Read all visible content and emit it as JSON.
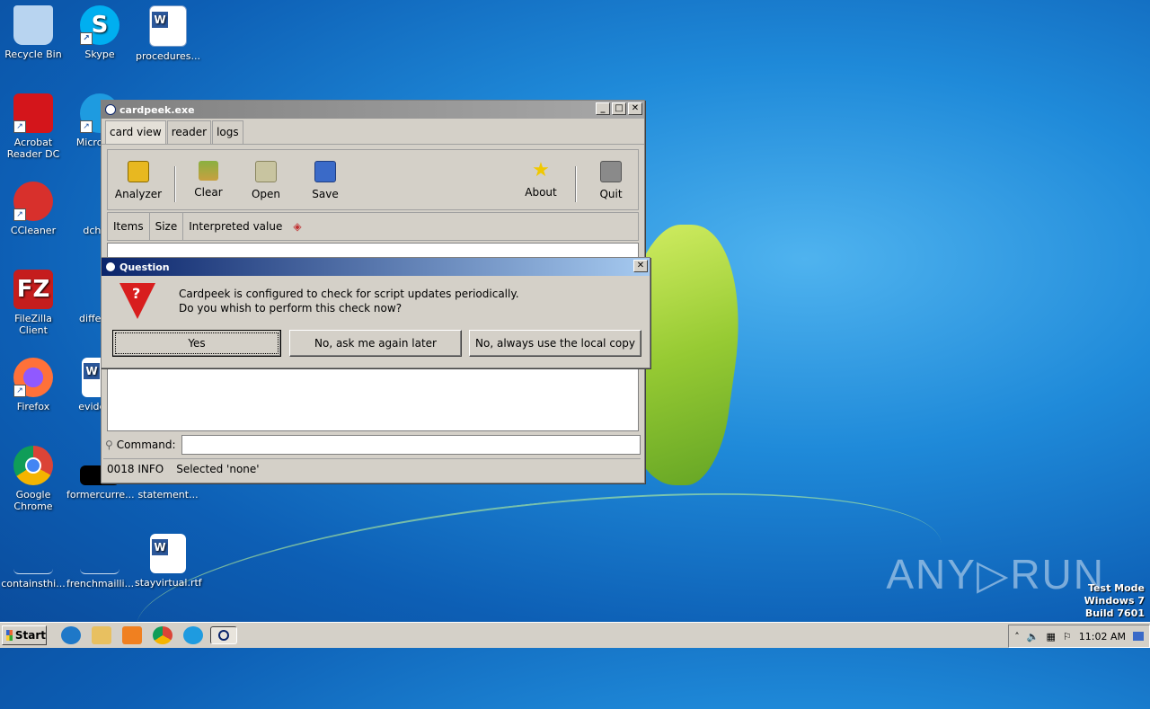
{
  "desktop": {
    "icons": [
      {
        "label": "Recycle Bin",
        "icon": "recycle-bin-icon",
        "color": "#b8d4f0"
      },
      {
        "label": "Skype",
        "icon": "skype-icon",
        "color": "#00aff0"
      },
      {
        "label": "procedures...",
        "icon": "word-document-icon",
        "color": "#2b579a"
      },
      {
        "label": "Acrobat Reader DC",
        "icon": "acrobat-icon",
        "color": "#d4151b"
      },
      {
        "label": "Microso...",
        "icon": "edge-icon",
        "color": "#1e9be0"
      },
      {
        "label": "CCleaner",
        "icon": "ccleaner-icon",
        "color": "#d8302c"
      },
      {
        "label": "dcha...",
        "icon": "file-icon",
        "color": "#1a6fc4"
      },
      {
        "label": "FileZilla Client",
        "icon": "filezilla-icon",
        "color": "#c51d1d"
      },
      {
        "label": "differe...",
        "icon": "file-icon",
        "color": "#1a6fc4"
      },
      {
        "label": "Firefox",
        "icon": "firefox-icon",
        "color": "#ff7139"
      },
      {
        "label": "eviden...",
        "icon": "word-document-icon",
        "color": "#2b579a"
      },
      {
        "label": "Google Chrome",
        "icon": "chrome-icon",
        "color": "#4285f4"
      },
      {
        "label": "formercurre...",
        "icon": "black-file-icon",
        "color": "#000000"
      },
      {
        "label": "statement...",
        "icon": "file-icon",
        "color": "#1a6fc4"
      },
      {
        "label": "containsthi...",
        "icon": "file-icon",
        "color": "#1a6fc4"
      },
      {
        "label": "frenchmailli...",
        "icon": "file-icon",
        "color": "#1a6fc4"
      },
      {
        "label": "stayvirtual.rtf",
        "icon": "word-document-icon",
        "color": "#2b579a"
      }
    ]
  },
  "main_window": {
    "title": "cardpeek.exe",
    "tabs": [
      {
        "label": "card view"
      },
      {
        "label": "reader"
      },
      {
        "label": "logs"
      }
    ],
    "toolbar": {
      "analyzer": "Analyzer",
      "clear": "Clear",
      "open": "Open",
      "save": "Save",
      "about": "About",
      "quit": "Quit"
    },
    "columns": {
      "items": "Items",
      "size": "Size",
      "interpreted": "Interpreted value"
    },
    "command_label": "Command:",
    "command_value": "",
    "status": {
      "code": "0018 INFO",
      "message": "Selected 'none'"
    }
  },
  "dialog": {
    "title": "Question",
    "message_line1": "Cardpeek is configured to check for script updates periodically.",
    "message_line2": "Do you whish to perform this check now?",
    "buttons": {
      "yes": "Yes",
      "later": "No, ask me again later",
      "local": "No, always use the local copy"
    }
  },
  "taskbar": {
    "start": "Start",
    "clock": "11:02 AM"
  },
  "watermark": "ANY▷RUN",
  "os_notice": {
    "line1": "Test Mode",
    "line2": "Windows 7",
    "line3": "Build 7601"
  },
  "colors": {
    "title_active": "#0a246a",
    "title_inactive": "#808080",
    "window_face": "#d4d0c8"
  }
}
